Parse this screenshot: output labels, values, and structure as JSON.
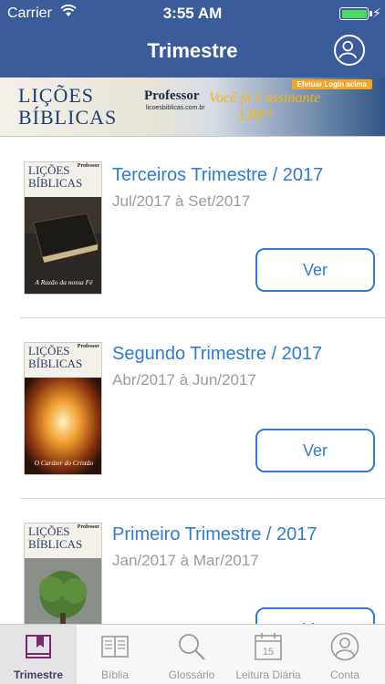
{
  "status_bar": {
    "carrier": "Carrier",
    "time": "3:55 AM"
  },
  "nav": {
    "title": "Trimestre"
  },
  "banner": {
    "logo_line1": "LIÇÕES",
    "logo_line2": "BÍBLICAS",
    "professor": "Professor",
    "site": "licoesbiblicas.com.br",
    "login": "Efetuar Login acima",
    "promo_line1": "Você já é assinante",
    "promo_line2": "LBP?"
  },
  "issues": [
    {
      "title": "Terceiros Trimestre / 2017",
      "period": "Jul/2017 à Set/2017",
      "button": "Ver",
      "cover_caption": "A Razão da nossa Fé",
      "cover_color": "#2b2722"
    },
    {
      "title": "Segundo Trimestre / 2017",
      "period": "Abr/2017 à Jun/2017",
      "button": "Ver",
      "cover_caption": "O Caráter do Cristão",
      "cover_color": "#7a3a12"
    },
    {
      "title": "Primeiro Trimestre / 2017",
      "period": "Jan/2017 à Mar/2017",
      "button": "Ver",
      "cover_caption": "",
      "cover_color": "#6f7a6a"
    }
  ],
  "cover_brand": {
    "line1": "LIÇÕES",
    "line2": "BÍBLICAS",
    "professor": "Professor"
  },
  "tabs": [
    {
      "label": "Trimestre",
      "icon": "bookmark-book-icon",
      "active": true
    },
    {
      "label": "Bíblia",
      "icon": "open-book-icon",
      "active": false
    },
    {
      "label": "Glossário",
      "icon": "magnifier-icon",
      "active": false
    },
    {
      "label": "Leitura Diária",
      "icon": "calendar-icon",
      "active": false,
      "day": "15"
    },
    {
      "label": "Conta",
      "icon": "person-icon",
      "active": false
    }
  ],
  "colors": {
    "nav_bg": "#3a5c9a",
    "accent": "#2f7cd5",
    "tab_active": "#7a2a6f"
  }
}
